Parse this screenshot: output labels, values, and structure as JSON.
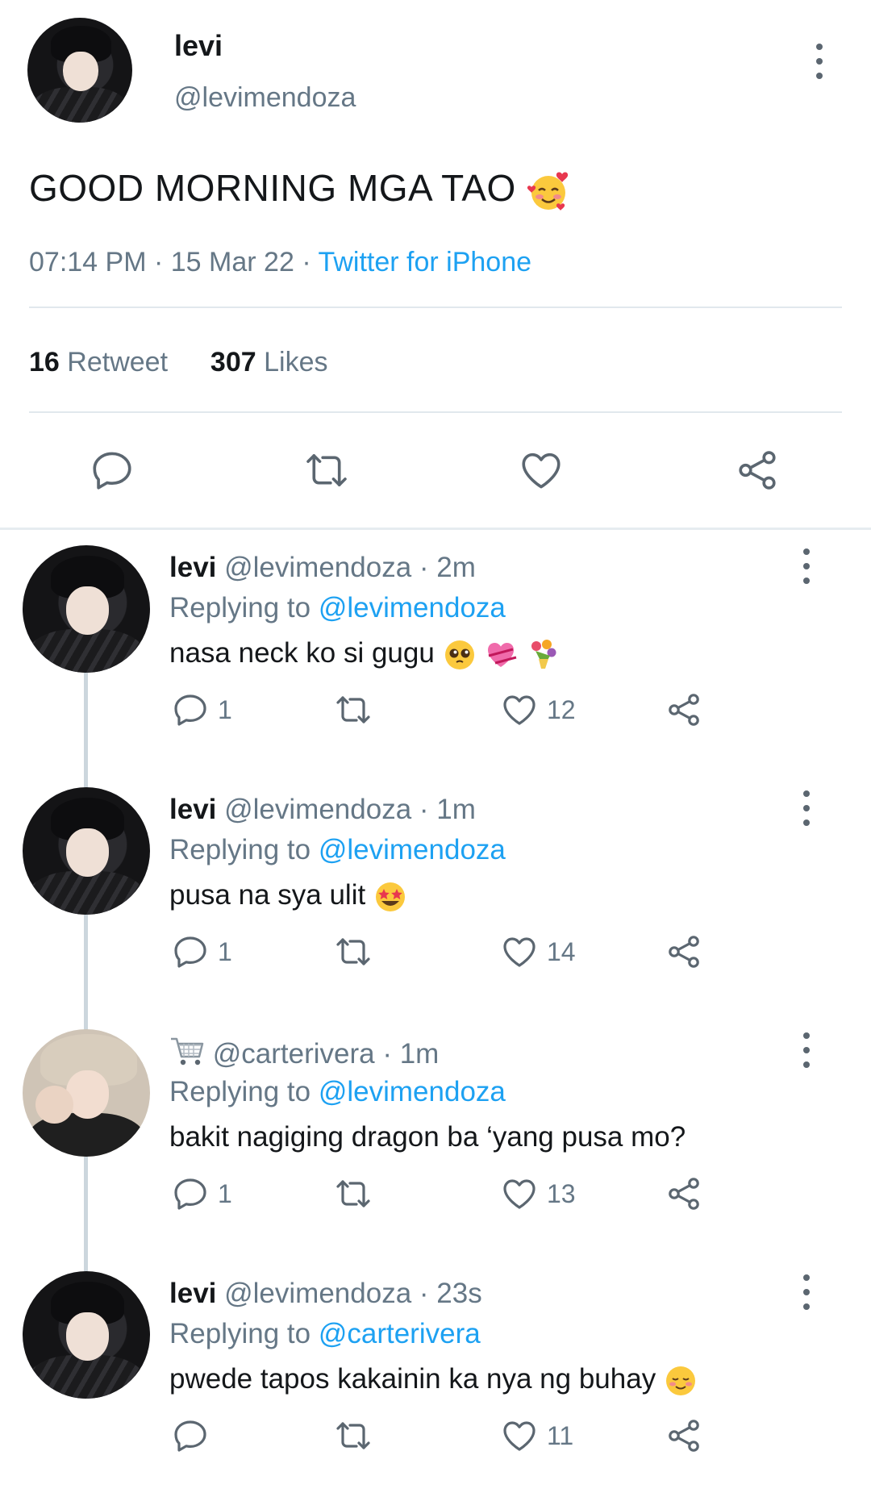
{
  "tweet": {
    "name": "levi",
    "handle": "@levimendoza",
    "text": "GOOD MORNING MGA TAO",
    "text_emoji": "smiling-face-with-hearts",
    "time": "07:14 PM",
    "date": "15 Mar 22",
    "source": "Twitter for iPhone",
    "retweets_count": "16",
    "retweets_label": "Retweet",
    "likes_count": "307",
    "likes_label": "Likes"
  },
  "replies": [
    {
      "name": "levi",
      "handle": "@levimendoza",
      "time": "2m",
      "replying_label": "Replying to",
      "replying_to": "@levimendoza",
      "text": "nasa neck ko si gugu",
      "emojis": [
        "pleading-face",
        "heart-with-ribbon",
        "bouquet"
      ],
      "reply_count": "1",
      "like_count": "12",
      "avatar": "dark-hair"
    },
    {
      "name": "levi",
      "handle": "@levimendoza",
      "time": "1m",
      "replying_label": "Replying to",
      "replying_to": "@levimendoza",
      "text": "pusa na sya ulit",
      "emojis": [
        "star-struck"
      ],
      "reply_count": "1",
      "like_count": "14",
      "avatar": "dark-hair"
    },
    {
      "name": "",
      "name_icon": "shopping-cart-icon",
      "handle": "@carterivera",
      "time": "1m",
      "replying_label": "Replying to",
      "replying_to": "@levimendoza",
      "text": "bakit nagiging dragon ba ‘yang pusa mo?",
      "emojis": [],
      "reply_count": "1",
      "like_count": "13",
      "avatar": "blonde-hair"
    },
    {
      "name": "levi",
      "handle": "@levimendoza",
      "time": "23s",
      "replying_label": "Replying to",
      "replying_to": "@carterivera",
      "text": "pwede tapos kakainin ka nya ng buhay",
      "emojis": [
        "smiling-face"
      ],
      "reply_count": "",
      "like_count": "11",
      "avatar": "dark-hair"
    }
  ],
  "colors": {
    "link": "#1da1f2",
    "muted": "#657786",
    "text": "#14171a",
    "divider": "#e1e8ed"
  }
}
